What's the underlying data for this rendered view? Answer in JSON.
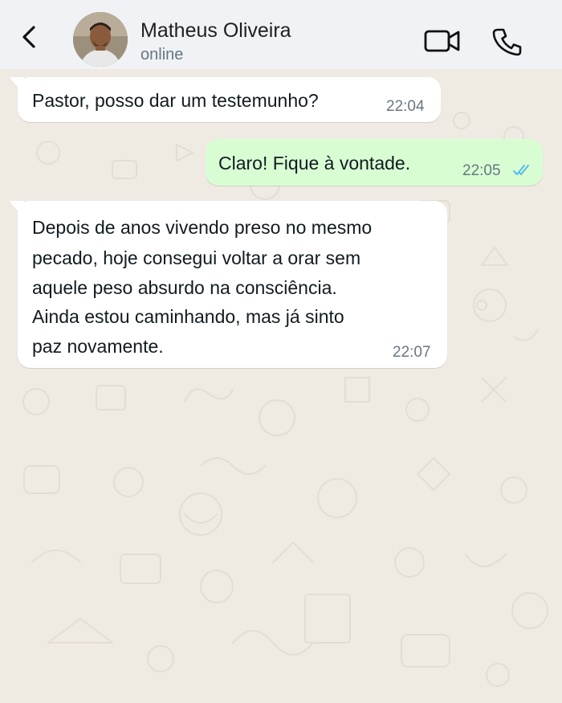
{
  "header": {
    "contact_name": "Matheus Oliveira",
    "status": "online",
    "back_icon": "chevron-left-icon",
    "video_icon": "video-camera-icon",
    "phone_icon": "phone-icon"
  },
  "messages": [
    {
      "direction": "in",
      "text": "Pastor, posso dar um testemunho?",
      "time": "22:04"
    },
    {
      "direction": "out",
      "text": "Claro! Fique à vontade.",
      "time": "22:05",
      "status": "read",
      "status_icon": "double-check-icon"
    },
    {
      "direction": "in",
      "lines": [
        "Depois de anos vivendo preso no mesmo",
        "pecado, hoje consegui voltar a orar sem",
        "aquele peso absurdo na consciência.",
        "Ainda estou caminhando, mas já sinto",
        "paz novamente."
      ],
      "time": "22:07"
    }
  ],
  "colors": {
    "wallpaper": "#efeae2",
    "header_bg": "#f0f2f5",
    "incoming_bubble": "#ffffff",
    "outgoing_bubble": "#d9fdd3",
    "read_ticks": "#53bdeb",
    "timestamp": "#667781"
  }
}
